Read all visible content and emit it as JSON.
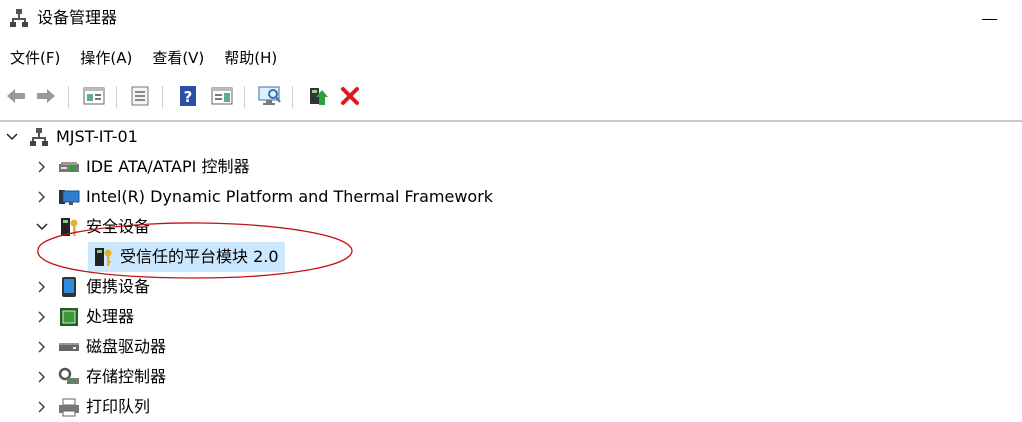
{
  "window": {
    "title": "设备管理器",
    "minimize_glyph": "—"
  },
  "menu": [
    {
      "id": "file",
      "label": "文件(F)"
    },
    {
      "id": "action",
      "label": "操作(A)"
    },
    {
      "id": "view",
      "label": "查看(V)"
    },
    {
      "id": "help",
      "label": "帮助(H)"
    }
  ],
  "toolbar": {
    "buttons": [
      "back-icon",
      "forward-icon",
      "properties-view-icon",
      "print-preview-icon",
      "help-icon",
      "panel-icon",
      "scan-hardware-icon",
      "update-driver-icon",
      "uninstall-icon"
    ],
    "colors": {
      "uninstall": "#e01b1b",
      "help": "#2a4fa8",
      "update": "#2ea043"
    }
  },
  "tree": {
    "root": {
      "label": "MJST-IT-01",
      "expanded": true
    },
    "items": [
      {
        "label": "IDE ATA/ATAPI 控制器",
        "expanded": false,
        "icon": "ide-controller-icon"
      },
      {
        "label": "Intel(R) Dynamic Platform and Thermal Framework",
        "expanded": false,
        "icon": "monitor-icon"
      },
      {
        "label": "安全设备",
        "expanded": true,
        "icon": "security-key-icon"
      },
      {
        "label": "受信任的平台模块 2.0",
        "child": true,
        "selected": true,
        "icon": "security-key-icon"
      },
      {
        "label": "便携设备",
        "expanded": false,
        "icon": "portable-device-icon"
      },
      {
        "label": "处理器",
        "expanded": false,
        "icon": "processor-icon"
      },
      {
        "label": "磁盘驱动器",
        "expanded": false,
        "icon": "disk-drive-icon"
      },
      {
        "label": "存储控制器",
        "expanded": false,
        "icon": "storage-controller-icon"
      },
      {
        "label": "打印队列",
        "expanded": false,
        "icon": "printer-icon"
      }
    ],
    "selection_color": "#cce8ff",
    "annotation_color": "#c0141b"
  }
}
